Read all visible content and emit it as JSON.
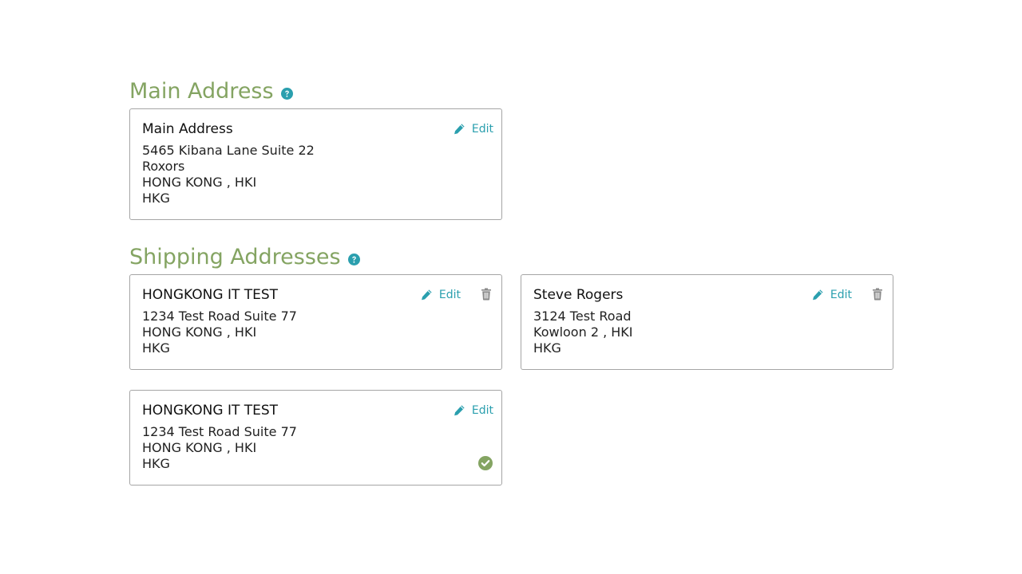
{
  "main_section": {
    "title": "Main Address",
    "card": {
      "name": "Main Address",
      "lines": [
        "5465 Kibana Lane Suite 22",
        "Roxors",
        "HONG KONG , HKI",
        "HKG"
      ],
      "edit_label": "Edit"
    }
  },
  "shipping_section": {
    "title": "Shipping Addresses",
    "cards": [
      {
        "name": "HONGKONG IT TEST",
        "lines": [
          "1234 Test Road Suite 77",
          "HONG KONG , HKI",
          "HKG"
        ],
        "edit_label": "Edit"
      },
      {
        "name": "Steve Rogers",
        "lines": [
          "3124 Test Road",
          "Kowloon 2 , HKI",
          "HKG"
        ],
        "edit_label": "Edit"
      },
      {
        "name": "HONGKONG IT TEST",
        "lines": [
          "1234 Test Road Suite 77",
          "HONG KONG , HKI",
          "HKG"
        ],
        "edit_label": "Edit"
      }
    ]
  },
  "icons": {
    "help": "question-circle-icon",
    "edit": "pencil-icon",
    "delete": "trash-icon",
    "default": "check-circle-icon"
  },
  "colors": {
    "heading": "#84a462",
    "link": "#2a9fae",
    "border": "#a5a5a5",
    "check": "#84a462",
    "trash": "#8a8a8a"
  }
}
